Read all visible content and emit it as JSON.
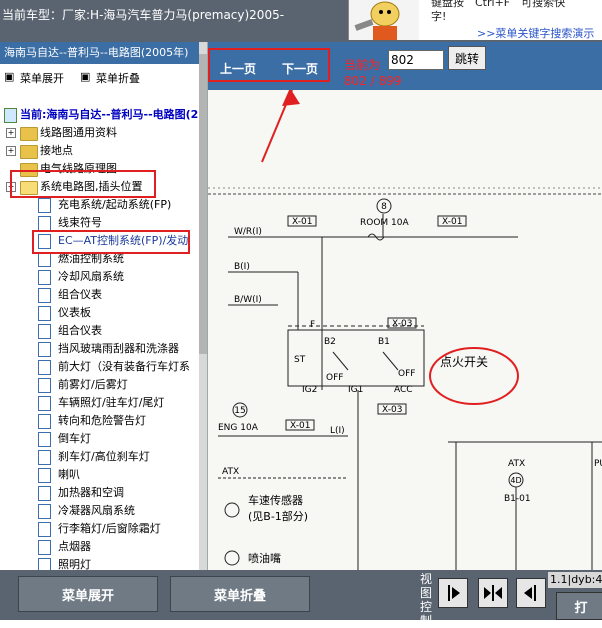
{
  "top": {
    "title": "当前车型：厂家:H-海马汽车普力马(premacy)2005-",
    "ad_line1": "键盘按　Ctrl+F　可搜索快",
    "ad_line1b": "字!",
    "ad_link": ">>菜单关键字搜索演示"
  },
  "sidebar": {
    "header": "海南马自达--普利马--电路图(2005年)",
    "expand_label": "菜单展开",
    "collapse_label": "菜单折叠",
    "current": "当前:海南马自达--普利马--电路图(2",
    "folders": [
      {
        "label": "线路图通用资料"
      },
      {
        "label": "接地点"
      },
      {
        "label": "电气线路原理图"
      },
      {
        "label": "系统电路图,插头位置"
      }
    ],
    "items": [
      {
        "label": "充电系统/起动系统(FP)"
      },
      {
        "label": "线束符号"
      },
      {
        "label": "EC—AT控制系统(FP)/发动"
      },
      {
        "label": "燃油控制系统"
      },
      {
        "label": "冷却风扇系统"
      },
      {
        "label": "组合仪表"
      },
      {
        "label": "仪表板"
      },
      {
        "label": "组合仪表"
      },
      {
        "label": "挡风玻璃雨刮器和洗涤器"
      },
      {
        "label": "前大灯（没有装备行车灯系"
      },
      {
        "label": "前雾灯/后雾灯"
      },
      {
        "label": "车辆照灯/驻车灯/尾灯"
      },
      {
        "label": "转向和危险警告灯"
      },
      {
        "label": "倒车灯"
      },
      {
        "label": "刹车灯/高位刹车灯"
      },
      {
        "label": "喇叭"
      },
      {
        "label": "加热器和空调"
      },
      {
        "label": "冷凝器风扇系统"
      },
      {
        "label": "行李箱灯/后窗除霜灯"
      },
      {
        "label": "点烟器"
      },
      {
        "label": "照明灯"
      }
    ]
  },
  "viewer": {
    "prev_label": "上一页",
    "next_label": "下一页",
    "current_label": "当前为",
    "page_value": "802",
    "jump_label": "跳转",
    "page_total": "802 / 899",
    "diagram": {
      "x01": "X-01",
      "x03": "X-03",
      "room": "ROOM 10A",
      "eng": "ENG 10A",
      "wr": "W/R(I)",
      "b": "B(I)",
      "bw": "B/W(I)",
      "l": "L(I)",
      "st": "ST",
      "ig2": "IG2",
      "ig1": "IG1",
      "acc": "ACC",
      "off": "OFF",
      "b1": "B1",
      "b2": "B2",
      "f": "F",
      "n8": "8",
      "n15": "15",
      "ignition": "点火开关",
      "atx": "ATX",
      "atx2": "ATX",
      "n4d": "4D",
      "b101": "B1-01",
      "p": "PU",
      "speed_sensor_1": "车速传感器",
      "speed_sensor_2": "(见B-1部分)",
      "injector": "喷油嘴"
    }
  },
  "bottom": {
    "expand_label": "菜单展开",
    "collapse_label": "菜单折叠",
    "view_label": "视图控制",
    "status": "1.1|dyb:4",
    "print_label": "打"
  },
  "colors": {
    "bar": "#5a6470",
    "nav": "#3a6ea5",
    "highlight": "#e02020"
  }
}
